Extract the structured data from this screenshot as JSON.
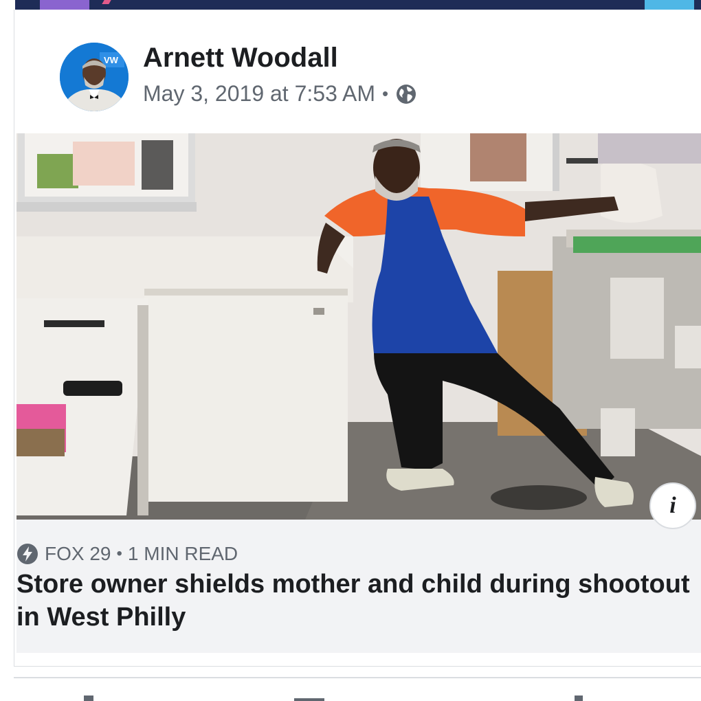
{
  "post": {
    "author_name": "Arnett Woodall",
    "timestamp": "May 3, 2019 at 7:53 AM",
    "meta_separator": "•",
    "privacy_icon": "globe-icon",
    "avatar_icon": "profile-photo"
  },
  "photo": {
    "info_label": "i",
    "info_icon": "info-icon"
  },
  "link_preview": {
    "source": "FOX 29",
    "separator": "•",
    "read_time": "1 MIN READ",
    "source_icon": "bolt-icon",
    "headline": "Store owner shields mother and child during shootout in West Philly"
  },
  "colors": {
    "header_strip": "#1e2c57",
    "name_text": "#1c1e21",
    "meta_text": "#606770",
    "preview_bg": "#f2f3f5",
    "avatar_bg": "#1479d4"
  }
}
